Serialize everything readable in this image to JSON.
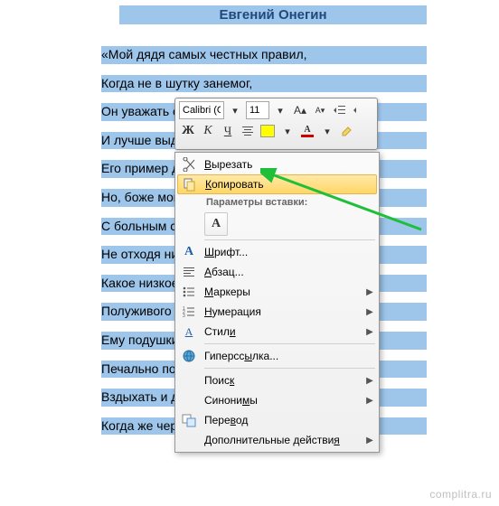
{
  "title": "Евгений Онегин",
  "poem": [
    "«Мой дядя самых честных правил,",
    "Когда не в шутку занемог,",
    "Он уважать себ",
    "И лучше выдумать не мог.",
    "Его пример дру",
    "Но, боже мой, к",
    "С больным сид",
    "Не отходя ни ш",
    "Какое низкое к",
    "Полуживого за",
    "Ему подушки п",
    "Печально подн",
    "Вздыхать и дум",
    "Когда же черт в"
  ],
  "mini": {
    "font": "Calibri (О",
    "size": "11"
  },
  "ctx": {
    "cut": "Вырезать",
    "copy": "Копировать",
    "paste_header": "Параметры вставки:",
    "paste_btn": "A",
    "font": "Шрифт...",
    "para": "Абзац...",
    "bullets": "Маркеры",
    "numbering": "Нумерация",
    "styles": "Стили",
    "hyperlink": "Гиперссылка...",
    "find": "Поиск",
    "synonyms": "Синонимы",
    "translate": "Перевод",
    "extra": "Дополнительные действия"
  },
  "watermark": "complitra.ru"
}
